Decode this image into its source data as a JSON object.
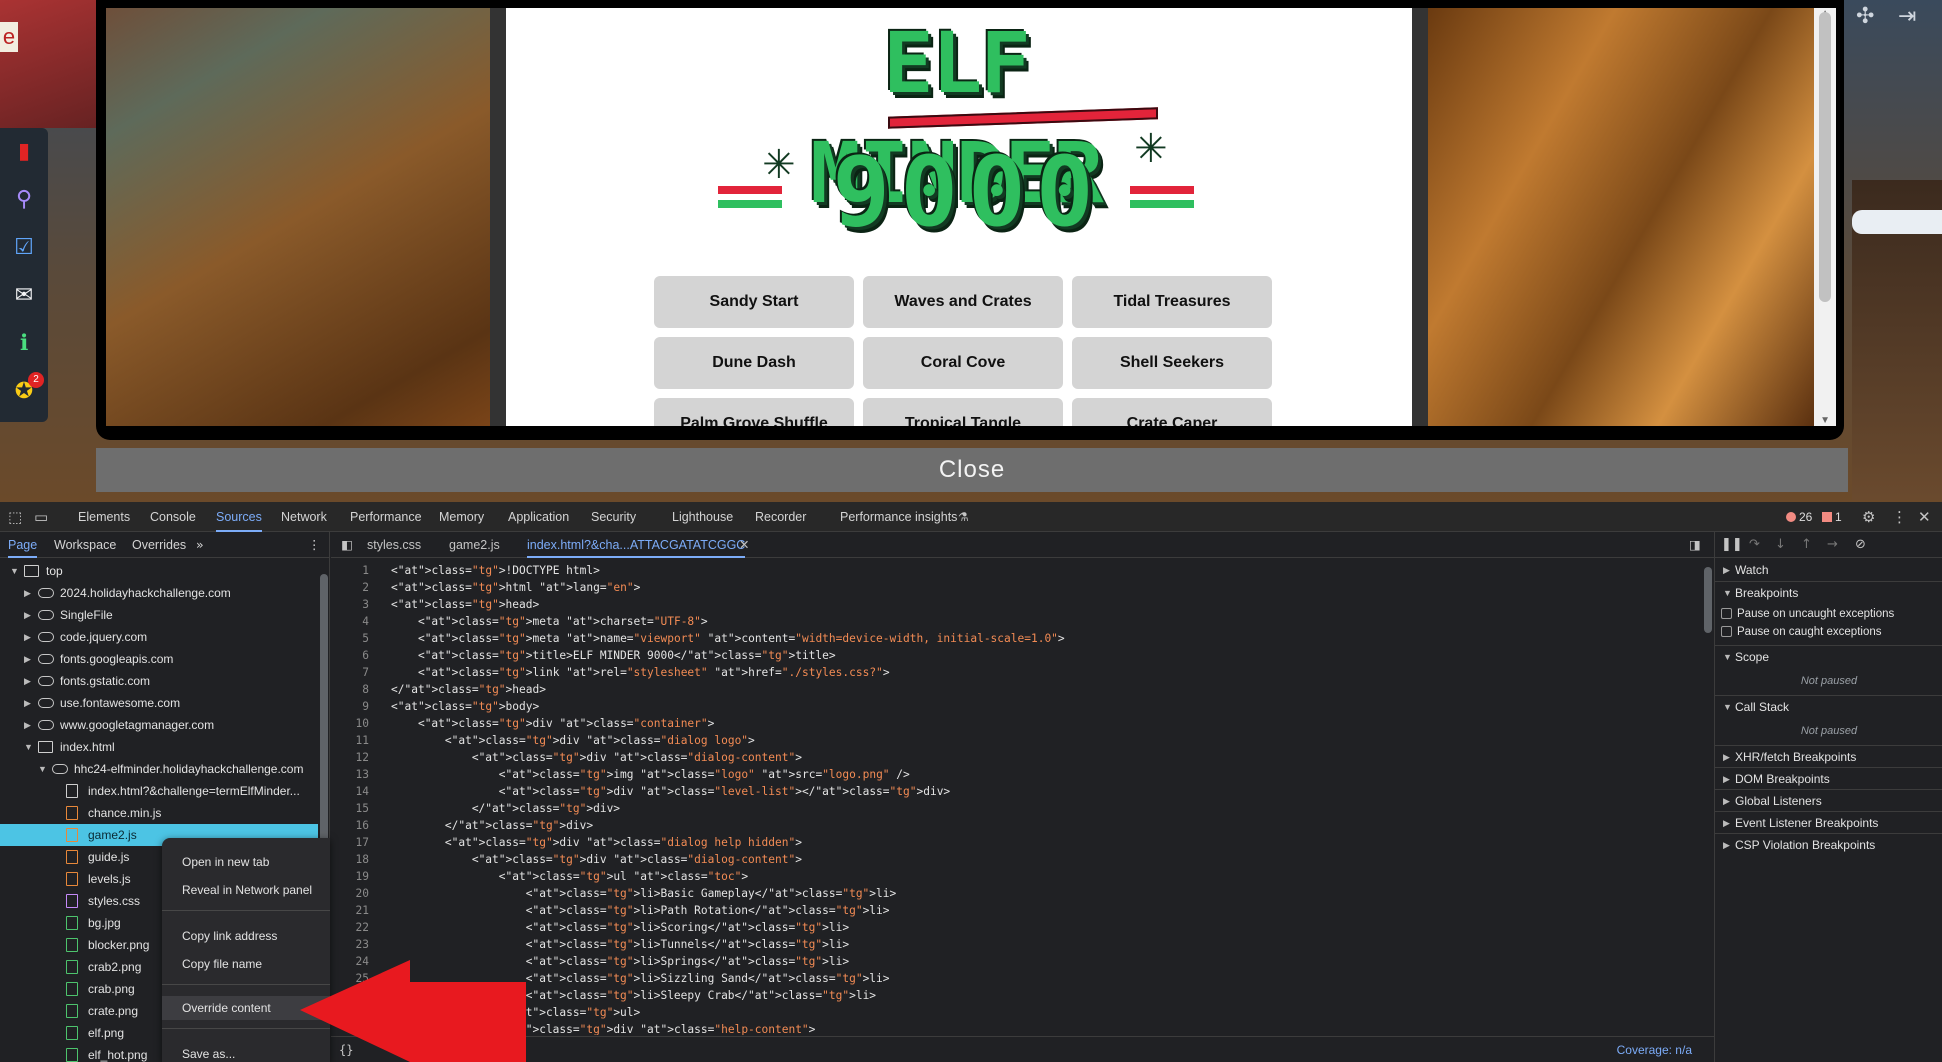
{
  "game": {
    "left_scene_letter": "e",
    "badge_count": "2",
    "sidebar_icons": [
      "book-icon",
      "map-pin-icon",
      "checklist-icon",
      "chat-icon",
      "info-icon",
      "achievement-icon"
    ],
    "top_right_icons": [
      "puzzle-icon",
      "exit-icon"
    ],
    "logo_line1": "ELF MINDER",
    "logo_line2": "9000",
    "levels": [
      "Sandy Start",
      "Waves and Crates",
      "Tidal Treasures",
      "Dune Dash",
      "Coral Cove",
      "Shell Seekers",
      "Palm Grove Shuffle",
      "Tropical Tangle",
      "Crate Caper"
    ],
    "close_label": "Close"
  },
  "devtools": {
    "tabs": [
      "Elements",
      "Console",
      "Sources",
      "Network",
      "Performance",
      "Memory",
      "Application",
      "Security",
      "Lighthouse",
      "Recorder",
      "Performance insights"
    ],
    "active_tab": "Sources",
    "error_count": "26",
    "warning_count": "1",
    "navigator_tabs": [
      "Page",
      "Workspace",
      "Overrides"
    ],
    "tree": [
      {
        "label": "top",
        "type": "frame",
        "depth": 0,
        "expanded": true
      },
      {
        "label": "2024.holidayhackchallenge.com",
        "type": "cloud",
        "depth": 1
      },
      {
        "label": "SingleFile",
        "type": "cloud",
        "depth": 1
      },
      {
        "label": "code.jquery.com",
        "type": "cloud",
        "depth": 1
      },
      {
        "label": "fonts.googleapis.com",
        "type": "cloud",
        "depth": 1
      },
      {
        "label": "fonts.gstatic.com",
        "type": "cloud",
        "depth": 1
      },
      {
        "label": "use.fontawesome.com",
        "type": "cloud",
        "depth": 1
      },
      {
        "label": "www.googletagmanager.com",
        "type": "cloud",
        "depth": 1
      },
      {
        "label": "index.html",
        "type": "frame",
        "depth": 1,
        "expanded": true
      },
      {
        "label": "hhc24-elfminder.holidayhackchallenge.com",
        "type": "cloud",
        "depth": 2,
        "expanded": true
      },
      {
        "label": "index.html?&challenge=termElfMinder...",
        "type": "doc",
        "depth": 3
      },
      {
        "label": "chance.min.js",
        "type": "js",
        "depth": 3
      },
      {
        "label": "game2.js",
        "type": "js",
        "depth": 3,
        "selected": true
      },
      {
        "label": "guide.js",
        "type": "js",
        "depth": 3
      },
      {
        "label": "levels.js",
        "type": "js",
        "depth": 3
      },
      {
        "label": "styles.css",
        "type": "css",
        "depth": 3
      },
      {
        "label": "bg.jpg",
        "type": "img",
        "depth": 3
      },
      {
        "label": "blocker.png",
        "type": "img",
        "depth": 3
      },
      {
        "label": "crab2.png",
        "type": "img",
        "depth": 3
      },
      {
        "label": "crab.png",
        "type": "img",
        "depth": 3
      },
      {
        "label": "crate.png",
        "type": "img",
        "depth": 3
      },
      {
        "label": "elf.png",
        "type": "img",
        "depth": 3
      },
      {
        "label": "elf_hot.png",
        "type": "img",
        "depth": 3
      }
    ],
    "editor_tabs": [
      "styles.css",
      "game2.js",
      "index.html?&cha...ATTACGATATCGGC"
    ],
    "active_editor_tab": "index.html?&cha...ATTACGATATCGGC",
    "code": [
      {
        "n": "1",
        "t": "<!DOCTYPE html>"
      },
      {
        "n": "2",
        "t": "<html lang=\"en\">"
      },
      {
        "n": "3",
        "t": "<head>"
      },
      {
        "n": "4",
        "t": "    <meta charset=\"UTF-8\">"
      },
      {
        "n": "5",
        "t": "    <meta name=\"viewport\" content=\"width=device-width, initial-scale=1.0\">"
      },
      {
        "n": "6",
        "t": "    <title>ELF MINDER 9000</title>"
      },
      {
        "n": "7",
        "t": "    <link rel=\"stylesheet\" href=\"./styles.css?\">"
      },
      {
        "n": "8",
        "t": "</head>"
      },
      {
        "n": "9",
        "t": "<body>"
      },
      {
        "n": "10",
        "t": "    <div class=\"container\">"
      },
      {
        "n": "11",
        "t": "        <div class=\"dialog logo\">"
      },
      {
        "n": "12",
        "t": "            <div class=\"dialog-content\">"
      },
      {
        "n": "13",
        "t": "                <img class=\"logo\" src=\"logo.png\" />"
      },
      {
        "n": "14",
        "t": "                <div class=\"level-list\"></div>"
      },
      {
        "n": "15",
        "t": "            </div>"
      },
      {
        "n": "16",
        "t": "        </div>"
      },
      {
        "n": "17",
        "t": "        <div class=\"dialog help hidden\">"
      },
      {
        "n": "18",
        "t": "            <div class=\"dialog-content\">"
      },
      {
        "n": "19",
        "t": "                <ul class=\"toc\">"
      },
      {
        "n": "20",
        "t": "                    <li>Basic Gameplay</li>"
      },
      {
        "n": "21",
        "t": "                    <li>Path Rotation</li>"
      },
      {
        "n": "22",
        "t": "                    <li>Scoring</li>"
      },
      {
        "n": "23",
        "t": "                    <li>Tunnels</li>"
      },
      {
        "n": "24",
        "t": "                    <li>Springs</li>"
      },
      {
        "n": "25",
        "t": "                    <li>Sizzling Sand</li>"
      },
      {
        "n": "",
        "t": "                    <li>Sleepy Crab</li>"
      },
      {
        "n": "",
        "t": "                </ul>"
      },
      {
        "n": "",
        "t": "                <div class=\"help-content\">"
      }
    ],
    "pretty_print": "{}",
    "coverage": "Coverage: n/a",
    "debugger": {
      "watch": "Watch",
      "breakpoints": "Breakpoints",
      "pause_uncaught": "Pause on uncaught exceptions",
      "pause_caught": "Pause on caught exceptions",
      "scope": "Scope",
      "scope_note": "Not paused",
      "call_stack": "Call Stack",
      "call_stack_note": "Not paused",
      "xhr": "XHR/fetch Breakpoints",
      "dom": "DOM Breakpoints",
      "global": "Global Listeners",
      "event": "Event Listener Breakpoints",
      "csp": "CSP Violation Breakpoints"
    },
    "context_menu": {
      "open_new_tab": "Open in new tab",
      "reveal_network": "Reveal in Network panel",
      "copy_link": "Copy link address",
      "copy_file_name": "Copy file name",
      "override_content": "Override content",
      "save_as": "Save as..."
    },
    "colors": {
      "accent": "#7cacf8",
      "selection": "#4cc4e4",
      "arrow": "#e8191f"
    }
  }
}
